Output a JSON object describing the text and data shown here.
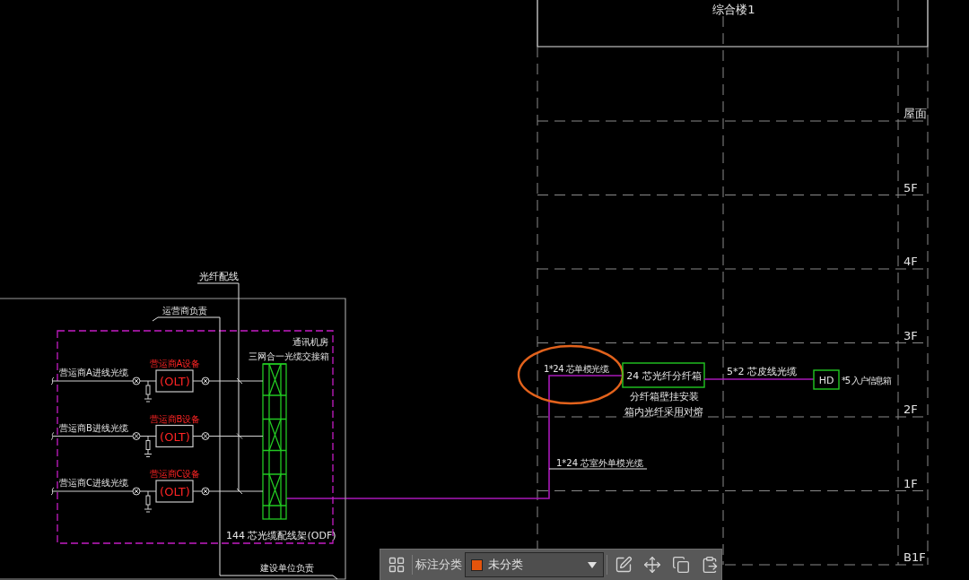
{
  "building": {
    "title": "综合楼1",
    "floors": [
      "屋面",
      "5F",
      "4F",
      "3F",
      "2F",
      "1F",
      "B1F"
    ]
  },
  "riser": {
    "cable_label": "1*24 芯单模光缆",
    "circled": true,
    "outdoor_cable_label": "1*24 芯室外单模光缆"
  },
  "distribution_box": {
    "label": "24 芯光纤分纤箱",
    "notes": [
      "分纤箱壁挂安装",
      "箱内光纤采用对熔"
    ]
  },
  "drop_cable": {
    "label": "5*2 芯皮线光缆"
  },
  "home_box": {
    "label": "HD",
    "note": "*5 入户信息箱"
  },
  "machine_room": {
    "top_label": "光纤配线",
    "operator_scope": "运营商负责",
    "room_label": "通讯机房",
    "cross_connect_label": "三网合一光缆交接箱",
    "operators": [
      {
        "cable": "营运商A进线光缆",
        "device": "营运商A设备",
        "device_type": "(OLT)"
      },
      {
        "cable": "营运商B进线光缆",
        "device": "营运商B设备",
        "device_type": "(OLT)"
      },
      {
        "cable": "营运商C进线光缆",
        "device": "营运商C设备",
        "device_type": "(OLT)"
      }
    ],
    "odf_label": "144 芯光缆配线架(ODF)",
    "owner_scope": "建设单位负责"
  },
  "toolbar": {
    "category_label": "标注分类",
    "category": {
      "value": "未分类",
      "color": "#e4540c"
    }
  }
}
